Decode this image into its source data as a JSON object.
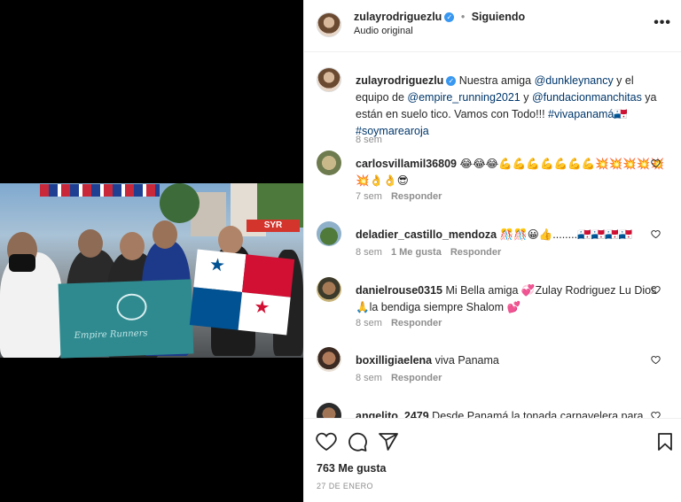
{
  "post": {
    "author": "zulayrodriguezlu",
    "separator": "•",
    "follow_status": "Siguiendo",
    "audio": "Audio original",
    "more_icon": "more-horizontal-icon",
    "verified_icon": "verified-badge-icon"
  },
  "caption": {
    "author": "zulayrodriguezlu",
    "text_1": " Nuestra amiga ",
    "mention_1": "@dunkleynancy",
    "text_2": " y el equipo de ",
    "mention_2": "@empire_running2021",
    "text_3": " y ",
    "mention_3": "@fundacionmanchitas",
    "text_4": " ya están en suelo tico. Vamos con Todo!!! ",
    "hashtag_1": "#vivapanamá🇵🇦",
    "hashtag_2": "#soymarearoja",
    "time": "8 sem"
  },
  "comments": [
    {
      "user": "carlosvillamil36809",
      "text": " 😂😂😂💪💪💪💪💪💪💪💥💥💥💥💥💥👌👌😎",
      "time": "7 sem",
      "likes": "",
      "reply": "Responder"
    },
    {
      "user": "deladier_castillo_mendoza",
      "text": " 🎊🎊😀👍........🇵🇦🇵🇦🇵🇦🇵🇦",
      "time": "8 sem",
      "likes": "1 Me gusta",
      "reply": "Responder"
    },
    {
      "user": "danielrouse0315",
      "text": " Mi Bella amiga 💞Zulay Rodriguez Lu Dios 🙏la bendiga siempre Shalom 💕",
      "time": "8 sem",
      "likes": "",
      "reply": "Responder"
    },
    {
      "user": "boxilligiaelena",
      "text": " viva Panama",
      "time": "8 sem",
      "likes": "",
      "reply": "Responder"
    },
    {
      "user": "angelito_2479",
      "text": " Desde Panamá la tonada carnavelera para",
      "time": "",
      "likes": "",
      "reply": ""
    }
  ],
  "actions": {
    "like_icon": "heart-icon",
    "comment_icon": "comment-icon",
    "share_icon": "share-icon",
    "save_icon": "bookmark-icon"
  },
  "likes_count": "763 Me gusta",
  "date": "27 DE ENERO",
  "media": {
    "banner_text": "Empire Runners"
  },
  "colors": {
    "link": "#00376b",
    "verified": "#3897f0",
    "muted": "#8e8e8e"
  }
}
